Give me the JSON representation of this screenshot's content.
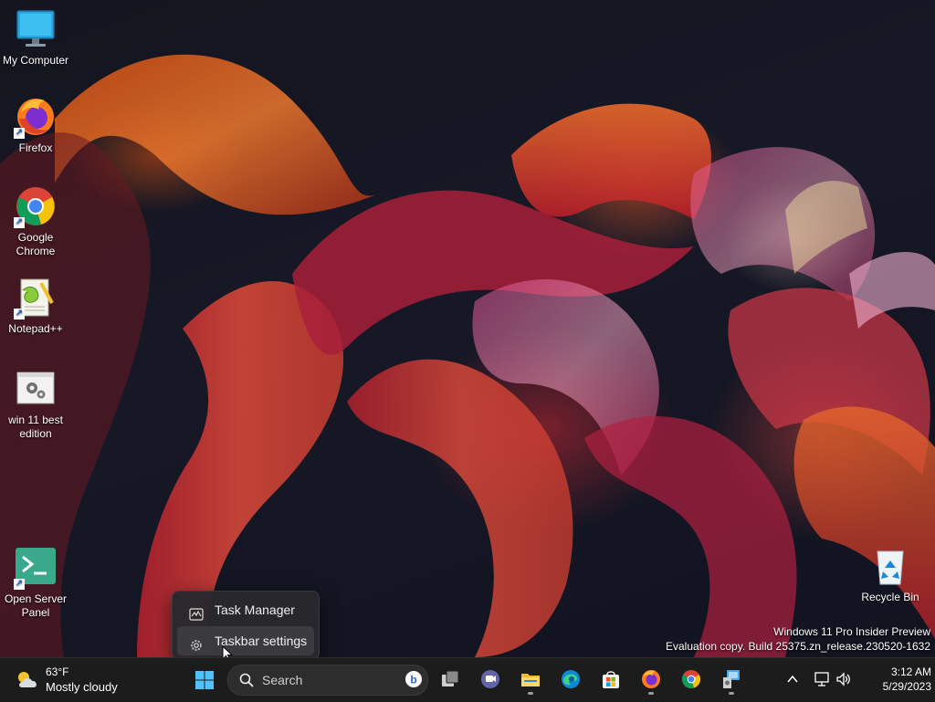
{
  "desktop": {
    "icons": [
      {
        "label": "My Computer"
      },
      {
        "label": "Firefox"
      },
      {
        "label": "Google Chrome"
      },
      {
        "label": "Notepad++"
      },
      {
        "label": "win 11 best edition"
      },
      {
        "label": "Open Server Panel"
      },
      {
        "label": "Recycle Bin"
      }
    ],
    "watermark": {
      "line1": "Windows 11 Pro Insider Preview",
      "line2": "Evaluation copy. Build 25375.zn_release.230520-1632"
    }
  },
  "context_menu": {
    "items": [
      {
        "label": "Task Manager",
        "icon": "task-manager-icon"
      },
      {
        "label": "Taskbar settings",
        "icon": "gear-icon",
        "hovered": true
      }
    ]
  },
  "taskbar": {
    "weather": {
      "temperature": "63°F",
      "condition": "Mostly cloudy",
      "icon": "cloud-sun-icon"
    },
    "search": {
      "placeholder": "Search"
    },
    "pinned": [
      {
        "name": "start",
        "icon": "windows-logo-icon"
      },
      {
        "name": "task-view",
        "icon": "task-view-icon"
      },
      {
        "name": "chat",
        "icon": "teams-chat-icon"
      },
      {
        "name": "file-explorer",
        "icon": "folder-icon",
        "running": true
      },
      {
        "name": "edge",
        "icon": "edge-icon"
      },
      {
        "name": "store",
        "icon": "store-icon"
      },
      {
        "name": "firefox",
        "icon": "firefox-icon",
        "running": true
      },
      {
        "name": "chrome",
        "icon": "chrome-icon"
      },
      {
        "name": "control-panel",
        "icon": "control-panel-icon",
        "running": true
      }
    ],
    "tray": {
      "time": "3:12 AM",
      "date": "5/29/2023"
    }
  },
  "colors": {
    "accent": "#0078d4",
    "taskbar_bg": "#1c1c1c",
    "menu_bg": "#28282c"
  }
}
